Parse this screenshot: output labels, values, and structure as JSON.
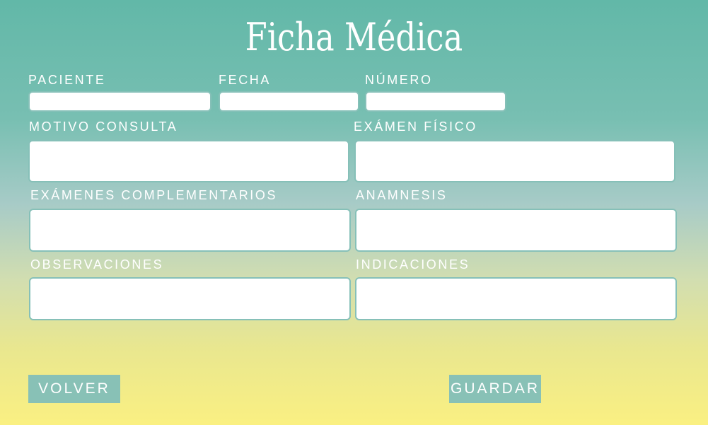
{
  "page": {
    "title": "Ficha Médica"
  },
  "form": {
    "paciente": {
      "label": "PACIENTE",
      "value": ""
    },
    "fecha": {
      "label": "FECHA",
      "value": ""
    },
    "numero": {
      "label": "NÚMERO",
      "value": ""
    },
    "motivo_consulta": {
      "label": "MOTIVO CONSULTA",
      "value": ""
    },
    "examen_fisico": {
      "label": "EXÁMEN FÍSICO",
      "value": ""
    },
    "examenes_complementarios": {
      "label": "EXÁMENES COMPLEMENTARIOS",
      "value": ""
    },
    "anamnesis": {
      "label": "ANAMNESIS",
      "value": ""
    },
    "observaciones": {
      "label": "OBSERVACIONES",
      "value": ""
    },
    "indicaciones": {
      "label": "INDICACIONES",
      "value": ""
    }
  },
  "actions": {
    "volver_label": "VOLVER",
    "guardar_label": "GUARDAR"
  },
  "colors": {
    "gradient_top": "#62b8a8",
    "gradient_bottom": "#faf082",
    "button": "#88c1b6",
    "field_border": "#86c0b8",
    "text": "#ffffff"
  }
}
